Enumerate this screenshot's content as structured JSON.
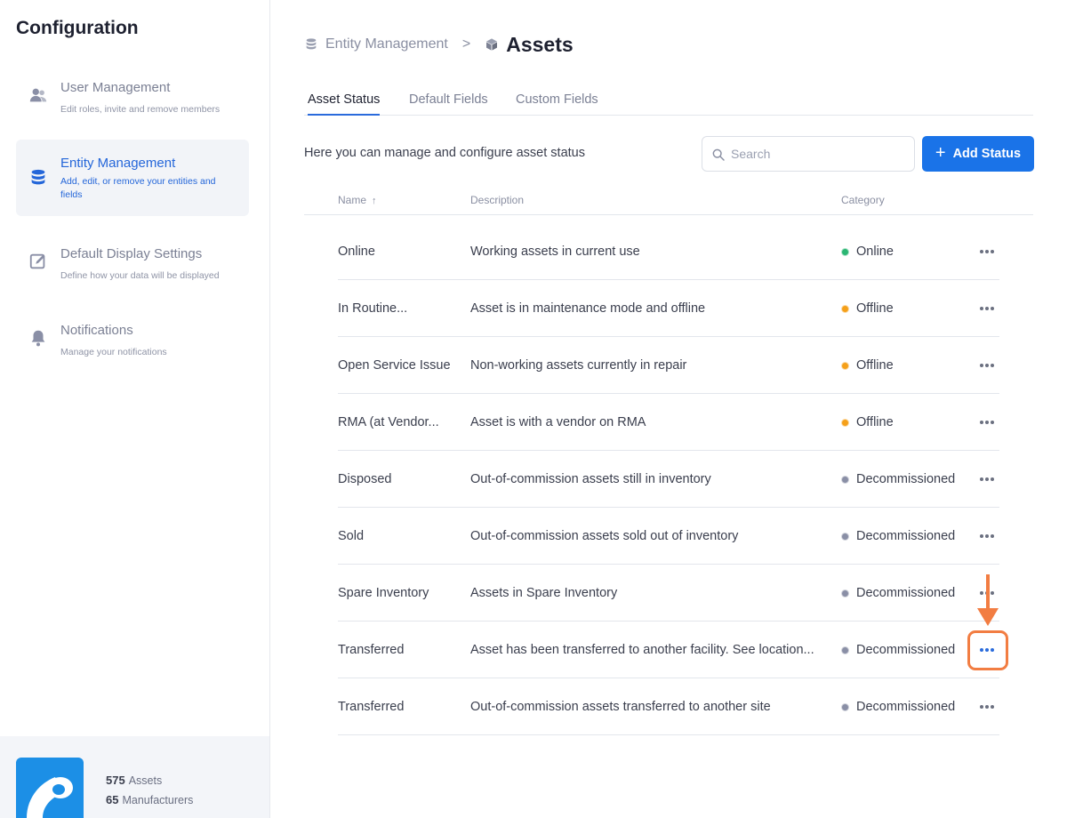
{
  "sidebar": {
    "title": "Configuration",
    "items": [
      {
        "label": "User Management",
        "desc": "Edit roles, invite and remove members",
        "icon": "users-icon"
      },
      {
        "label": "Entity Management",
        "desc": "Add, edit, or remove your entities and fields",
        "icon": "database-icon"
      },
      {
        "label": "Default Display Settings",
        "desc": "Define how your data will be displayed",
        "icon": "edit-icon"
      },
      {
        "label": "Notifications",
        "desc": "Manage your notifications",
        "icon": "bell-icon"
      }
    ],
    "footer": {
      "assets_count": "575",
      "assets_label": "Assets",
      "manufacturers_count": "65",
      "manufacturers_label": "Manufacturers"
    }
  },
  "breadcrumb": {
    "parent": "Entity Management",
    "separator": ">",
    "current": "Assets"
  },
  "tabs": [
    "Asset Status",
    "Default Fields",
    "Custom Fields"
  ],
  "intro": "Here you can manage and configure asset status",
  "search": {
    "placeholder": "Search"
  },
  "add_button": {
    "label": "Add Status"
  },
  "table": {
    "headers": {
      "name": "Name",
      "description": "Description",
      "category": "Category"
    },
    "rows": [
      {
        "name": "Online",
        "description": "Working assets in current use",
        "category": "Online"
      },
      {
        "name": "In Routine...",
        "description": "Asset is in maintenance mode and offline",
        "category": "Offline"
      },
      {
        "name": "Open Service Issue",
        "description": "Non-working assets currently in repair",
        "category": "Offline"
      },
      {
        "name": "RMA (at Vendor...",
        "description": "Asset is with a vendor on RMA",
        "category": "Offline"
      },
      {
        "name": "Disposed",
        "description": "Out-of-commission assets still in inventory",
        "category": "Decommissioned"
      },
      {
        "name": "Sold",
        "description": "Out-of-commission assets sold out of inventory",
        "category": "Decommissioned"
      },
      {
        "name": "Spare Inventory",
        "description": "Assets in Spare Inventory",
        "category": "Decommissioned"
      },
      {
        "name": "Transferred",
        "description": "Asset has been transferred to another facility. See location...",
        "category": "Decommissioned"
      },
      {
        "name": "Transferred",
        "description": "Out-of-commission assets transferred to another site",
        "category": "Decommissioned"
      }
    ]
  },
  "colors": {
    "accent": "#1a73e8",
    "online": "#2bb673",
    "offline": "#f5a01a",
    "decommissioned": "#8a8fa6",
    "annotation": "#f27d42"
  }
}
